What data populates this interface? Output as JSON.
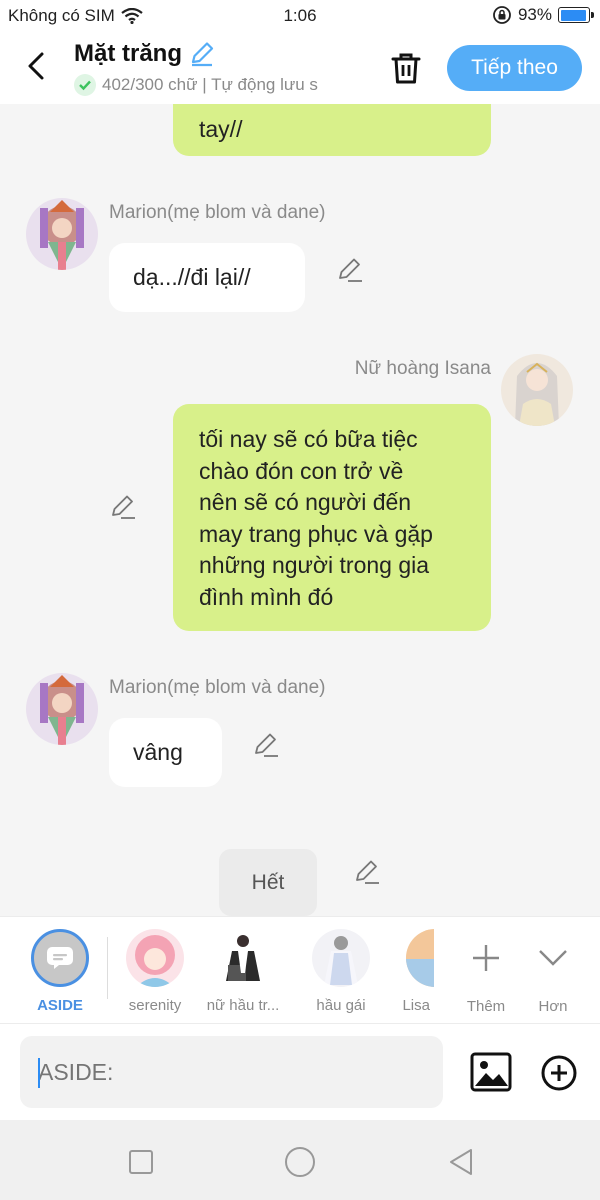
{
  "status_bar": {
    "carrier": "Không có SIM",
    "time": "1:06",
    "battery": "93%",
    "battery_level": 0.93
  },
  "header": {
    "title": "Mặt trăng",
    "subtitle": "402/300 chữ | Tự động lưu s",
    "next_label": "Tiếp theo"
  },
  "messages": {
    "m0": {
      "text": "tay//"
    },
    "m1": {
      "name": "Marion(mẹ blom và dane)",
      "text": "dạ...//đi lại//"
    },
    "m2": {
      "name": "Nữ hoàng Isana",
      "lines": [
        "tối nay sẽ có bữa tiệc",
        "chào đón con trở về",
        "nên sẽ có người đến",
        "may trang phục và gặp",
        "những người trong gia",
        "đình mình đó"
      ]
    },
    "m3": {
      "name": "Marion(mẹ blom và dane)",
      "text": "vâng"
    },
    "m4": {
      "text": "Hết"
    }
  },
  "characters": {
    "aside": "ASIDE",
    "serenity": "serenity",
    "maid_head": "nữ hầu tr...",
    "maid": "hầu gái",
    "lisa": "Lisa",
    "add": "Thêm",
    "more": "Hơn"
  },
  "input": {
    "placeholder": "ASIDE:"
  },
  "colors": {
    "accent": "#55adf7",
    "green_bubble": "#d8f08a",
    "aside_active": "#4a90e2"
  }
}
